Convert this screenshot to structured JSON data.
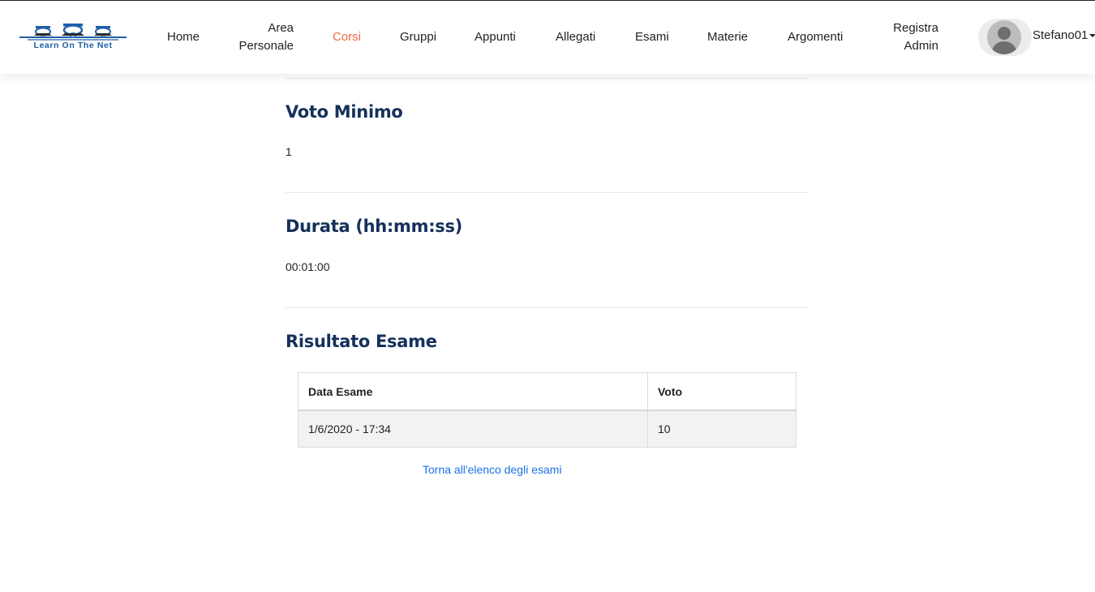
{
  "header": {
    "logo_text": "Learn On The Net",
    "nav": {
      "home": "Home",
      "area_personale_line1": "Area",
      "area_personale_line2": "Personale",
      "corsi": "Corsi",
      "gruppi": "Gruppi",
      "appunti": "Appunti",
      "allegati": "Allegati",
      "esami": "Esami",
      "materie": "Materie",
      "argomenti": "Argomenti",
      "registra_admin_line1": "Registra",
      "registra_admin_line2": "Admin"
    },
    "active_item": "Corsi",
    "user_name": "Stefano01"
  },
  "sections": {
    "voto_minimo": {
      "title": "Voto Minimo",
      "value": "1"
    },
    "durata": {
      "title": "Durata (hh:mm:ss)",
      "value": "00:01:00"
    },
    "risultato": {
      "title": "Risultato Esame",
      "columns": [
        "Data Esame",
        "Voto"
      ],
      "rows": [
        [
          "1/6/2020 - 17:34",
          "10"
        ]
      ]
    }
  },
  "back_link": "Torna all'elenco degli esami",
  "colors": {
    "accent": "#ef6a3f",
    "heading": "#15305a",
    "link": "#1a73e8"
  }
}
